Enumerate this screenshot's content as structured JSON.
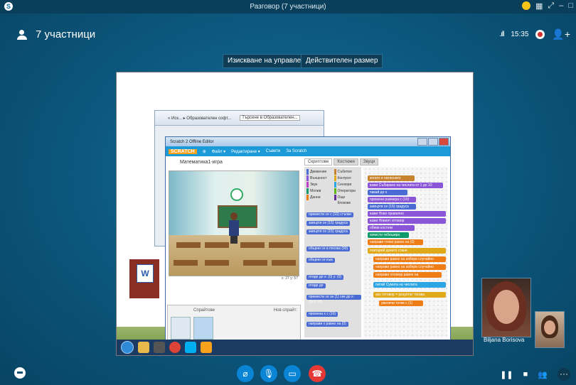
{
  "window": {
    "title": "Разговор (7 участници)"
  },
  "header": {
    "participants_label": "7 участници",
    "time": "15:35"
  },
  "toolbar": {
    "request_control_label": "Изискване на управлението",
    "actual_size_label": "Действителен размер"
  },
  "explorer": {
    "path": "« Иск... ▸ Образователен софт...",
    "search_placeholder": "Търсене в Образователен..."
  },
  "scratch": {
    "window_title": "Scratch 2 Offline Editor",
    "brand": "SCRATCH",
    "menu": [
      "Файл ▾",
      "Редактиране ▾",
      "Съвети",
      "За Scratch"
    ],
    "project_name": "Математика1-игра",
    "tabs": [
      "Скриптове",
      "Костюми",
      "Звуци"
    ],
    "categories": [
      "Движение",
      "Събития",
      "Външност",
      "Контрол",
      "Звук",
      "Сензори",
      "Молив",
      "Оператори",
      "Данни",
      "Още блокове"
    ],
    "palette_blocks": [
      "премести се с (10) стъпки",
      "завърти се (15) градуса",
      "завърти се (15) градуса",
      "обърни се в посока (90)",
      "обърни се към",
      "отиде до х: (0) у: (0)",
      "отиде до",
      "премести се за (1) сек до х: (0) у: (0)",
      "промени х с (10)",
      "направи х равно на (0)"
    ],
    "script_blocks": [
      "когато е натиснато",
      "кажи Събиране на числата от 1 до 10",
      "чакай до х",
      "промени размера с (10)",
      "завърти се (15) градуса",
      "кажи Ново правилно",
      "кажи Новият отговор",
      "обяви костюм",
      "изчисти тебешира",
      "направи точки равно на (0)",
      "повтаряй докато стане",
      "направи равно на избери случайно",
      "направи равно на избери случайно",
      "направи отговор равно на",
      "питай Сумата на числата",
      "ако отговор = резултат тогава",
      "увеличи точки с (1)"
    ],
    "sprite_panel_label": "Спрайтове",
    "new_sprite_label": "Нов спрайт:",
    "coords": "x: 27  y: 57"
  },
  "participants": [
    {
      "name": "Biljana Borisova"
    },
    {
      "name": ""
    }
  ],
  "colors": {
    "background": "#0d5a82",
    "end_call": "#e53935",
    "control_blue": "#0a85d6"
  }
}
